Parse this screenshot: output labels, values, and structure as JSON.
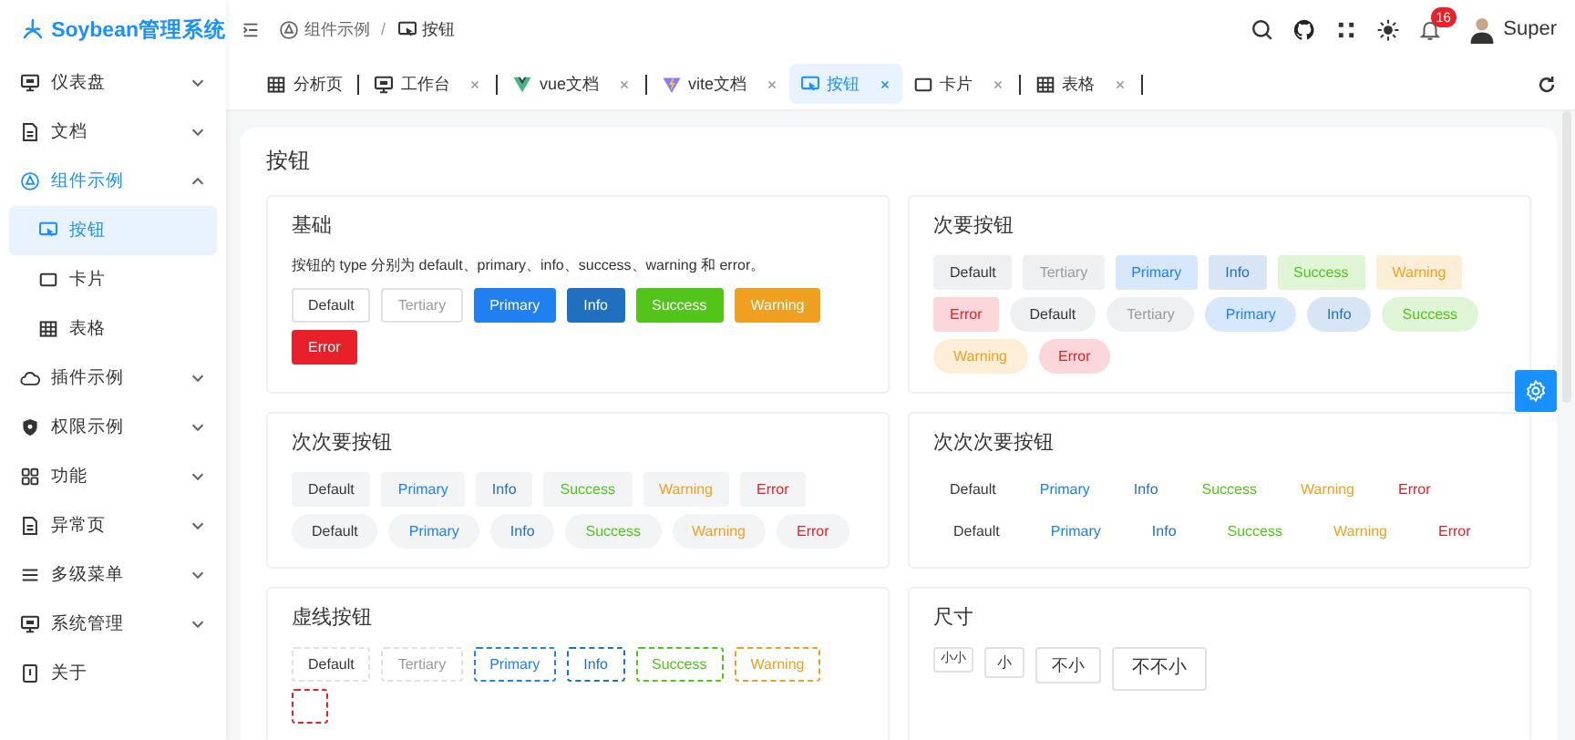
{
  "brand": {
    "title": "Soybean管理系统"
  },
  "sidebar": {
    "items": [
      {
        "label": "仪表盘",
        "expanded": false,
        "selected": false
      },
      {
        "label": "文档",
        "expanded": false,
        "selected": false
      },
      {
        "label": "组件示例",
        "expanded": true,
        "selected": true,
        "children": [
          {
            "label": "按钮",
            "selected": true
          },
          {
            "label": "卡片",
            "selected": false
          },
          {
            "label": "表格",
            "selected": false
          }
        ]
      },
      {
        "label": "插件示例",
        "expanded": false,
        "selected": false
      },
      {
        "label": "权限示例",
        "expanded": false,
        "selected": false
      },
      {
        "label": "功能",
        "expanded": false,
        "selected": false
      },
      {
        "label": "异常页",
        "expanded": false,
        "selected": false
      },
      {
        "label": "多级菜单",
        "expanded": false,
        "selected": false
      },
      {
        "label": "系统管理",
        "expanded": false,
        "selected": false
      },
      {
        "label": "关于",
        "selected": false
      }
    ]
  },
  "header": {
    "breadcrumb": [
      "组件示例",
      "/",
      "按钮"
    ],
    "notification_count": "16",
    "user": "Super"
  },
  "tabs": [
    {
      "label": "分析页",
      "closable": false,
      "selected": false
    },
    {
      "label": "工作台",
      "closable": true,
      "selected": false
    },
    {
      "label": "vue文档",
      "closable": true,
      "selected": false
    },
    {
      "label": "vite文档",
      "closable": true,
      "selected": false
    },
    {
      "label": "按钮",
      "closable": true,
      "selected": true
    },
    {
      "label": "卡片",
      "closable": true,
      "selected": false
    },
    {
      "label": "表格",
      "closable": true,
      "selected": false
    }
  ],
  "page": {
    "title": "按钮",
    "sections": [
      {
        "title": "基础",
        "kind": "solid",
        "description": "按钮的 type 分别为 default、primary、info、success、warning 和 error。",
        "buttons": [
          {
            "label": "Default",
            "color": "#333639",
            "round": false
          },
          {
            "label": "Tertiary",
            "color": "#9a9a9a",
            "round": false
          },
          {
            "label": "Primary",
            "color": "#2080f0",
            "round": false
          },
          {
            "label": "Info",
            "color": "#2070c0",
            "round": false
          },
          {
            "label": "Success",
            "color": "#52c41a",
            "round": false
          },
          {
            "label": "Warning",
            "color": "#f0a020",
            "round": false
          },
          {
            "label": "Error",
            "color": "#e8202a",
            "round": false
          }
        ]
      },
      {
        "title": "次要按钮",
        "kind": "secondary",
        "buttons": [
          {
            "label": "Default",
            "color": "#333639",
            "round": false
          },
          {
            "label": "Tertiary",
            "color": "#9a9a9a",
            "round": false
          },
          {
            "label": "Primary",
            "color": "#2080f0",
            "round": false
          },
          {
            "label": "Info",
            "color": "#2070c0",
            "round": false
          },
          {
            "label": "Success",
            "color": "#52c41a",
            "round": false
          },
          {
            "label": "Warning",
            "color": "#f0a020",
            "round": false
          },
          {
            "label": "Error",
            "color": "#e8202a",
            "round": false
          },
          {
            "label": "Default",
            "color": "#333639",
            "round": true
          },
          {
            "label": "Tertiary",
            "color": "#9a9a9a",
            "round": true
          },
          {
            "label": "Primary",
            "color": "#2080f0",
            "round": true
          },
          {
            "label": "Info",
            "color": "#2070c0",
            "round": true
          },
          {
            "label": "Success",
            "color": "#52c41a",
            "round": true
          },
          {
            "label": "Warning",
            "color": "#f0a020",
            "round": true
          },
          {
            "label": "Error",
            "color": "#e8202a",
            "round": true
          }
        ]
      },
      {
        "title": "次次要按钮",
        "kind": "tertiary",
        "buttons": [
          {
            "label": "Default",
            "color": "#333639",
            "round": false
          },
          {
            "label": "Primary",
            "color": "#2080f0",
            "round": false
          },
          {
            "label": "Info",
            "color": "#2070c0",
            "round": false
          },
          {
            "label": "Success",
            "color": "#52c41a",
            "round": false
          },
          {
            "label": "Warning",
            "color": "#f0a020",
            "round": false
          },
          {
            "label": "Error",
            "color": "#e8202a",
            "round": false
          },
          {
            "label": "Default",
            "color": "#333639",
            "round": true
          },
          {
            "label": "Primary",
            "color": "#2080f0",
            "round": true
          },
          {
            "label": "Info",
            "color": "#2070c0",
            "round": true
          },
          {
            "label": "Success",
            "color": "#52c41a",
            "round": true
          },
          {
            "label": "Warning",
            "color": "#f0a020",
            "round": true
          },
          {
            "label": "Error",
            "color": "#e8202a",
            "round": true
          }
        ]
      },
      {
        "title": "次次次要按钮",
        "kind": "quaternary",
        "buttons": [
          {
            "label": "Default",
            "color": "#333639",
            "round": false
          },
          {
            "label": "Primary",
            "color": "#2080f0",
            "round": false
          },
          {
            "label": "Info",
            "color": "#2070c0",
            "round": false
          },
          {
            "label": "Success",
            "color": "#52c41a",
            "round": false
          },
          {
            "label": "Warning",
            "color": "#f0a020",
            "round": false
          },
          {
            "label": "Error",
            "color": "#e8202a",
            "round": false
          },
          {
            "label": "Default",
            "color": "#333639",
            "round": true
          },
          {
            "label": "Primary",
            "color": "#2080f0",
            "round": true
          },
          {
            "label": "Info",
            "color": "#2070c0",
            "round": true
          },
          {
            "label": "Success",
            "color": "#52c41a",
            "round": true
          },
          {
            "label": "Warning",
            "color": "#f0a020",
            "round": true
          },
          {
            "label": "Error",
            "color": "#e8202a",
            "round": true
          }
        ]
      },
      {
        "title": "虚线按钮",
        "kind": "dashed",
        "buttons": [
          {
            "label": "Default",
            "color": "#333639",
            "round": false
          },
          {
            "label": "Tertiary",
            "color": "#9a9a9a",
            "round": false
          },
          {
            "label": "Primary",
            "color": "#2080f0",
            "round": false
          },
          {
            "label": "Info",
            "color": "#2070c0",
            "round": false
          },
          {
            "label": "Success",
            "color": "#52c41a",
            "round": false
          },
          {
            "label": "Warning",
            "color": "#f0a020",
            "round": false
          },
          {
            "color": "#e8202a",
            "round": false
          }
        ]
      },
      {
        "title": "尺寸",
        "kind": "sizes",
        "buttons": [
          {
            "label": "小小",
            "kind": "tiny"
          },
          {
            "label": "小",
            "kind": "small"
          },
          {
            "label": "不小",
            "kind": "medium"
          },
          {
            "label": "不不小",
            "kind": "large"
          }
        ]
      }
    ]
  }
}
